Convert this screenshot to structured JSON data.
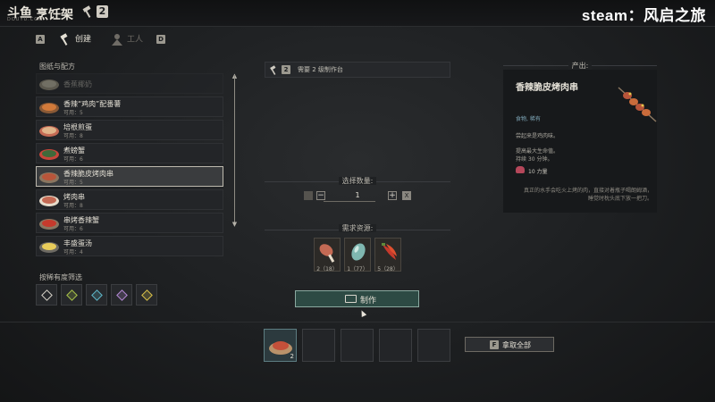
{
  "topbar": {
    "logo": "斗鱼",
    "logo_sub": "DOUYU.COM",
    "title": "烹饪架",
    "level_badge": "2",
    "watermark": "steam：风启之旅"
  },
  "tabs": {
    "prev_key": "A",
    "next_key": "D",
    "items": [
      {
        "label": "创建",
        "icon": "hammer-icon",
        "active": true
      },
      {
        "label": "工人",
        "icon": "worker-icon",
        "active": false
      }
    ]
  },
  "recipes": {
    "header": "图纸与配方",
    "items": [
      {
        "name": "香蕉椰奶",
        "sub": "",
        "faded": true,
        "selected": false,
        "icon": "coconut-milk-icon"
      },
      {
        "name": "香辣“鸡肉”配番薯",
        "sub": "可用：5",
        "faded": false,
        "selected": false,
        "icon": "chicken-plate-icon"
      },
      {
        "name": "培根煎蛋",
        "sub": "可用：8",
        "faded": false,
        "selected": false,
        "icon": "bacon-egg-icon"
      },
      {
        "name": "煮螃蟹",
        "sub": "可用：6",
        "faded": false,
        "selected": false,
        "icon": "crab-icon"
      },
      {
        "name": "香辣脆皮烤肉串",
        "sub": "可用：5",
        "faded": false,
        "selected": true,
        "icon": "skewer-icon"
      },
      {
        "name": "烤肉串",
        "sub": "可用：8",
        "faded": false,
        "selected": false,
        "icon": "meat-skewer-icon"
      },
      {
        "name": "串烤香辣蟹",
        "sub": "可用：6",
        "faded": false,
        "selected": false,
        "icon": "crab-skewer-icon"
      },
      {
        "name": "丰盛蛋汤",
        "sub": "可用：4",
        "faded": false,
        "selected": false,
        "icon": "egg-soup-icon"
      }
    ]
  },
  "filter": {
    "header": "按稀有度筛选",
    "gem_colors": [
      "#d8d4ca",
      "#a9c44a",
      "#5fb7c9",
      "#b58ad6",
      "#d9c24a"
    ]
  },
  "requirement": {
    "badge": "2",
    "text": "需要 2 级制作台"
  },
  "quantity": {
    "header": "选择数量:",
    "value": "1",
    "minus": "−",
    "plus": "+",
    "max_key": "X"
  },
  "resources": {
    "header": "需求资源:",
    "items": [
      {
        "icon": "raw-meat-icon",
        "count": "2（18）"
      },
      {
        "icon": "crystal-icon",
        "count": "1（77）"
      },
      {
        "icon": "chili-pepper-icon",
        "count": "5（28）"
      }
    ]
  },
  "craft": {
    "label": "制作"
  },
  "output": {
    "header": "产出:",
    "name": "香辣脆皮烤肉串",
    "tags": "食物, 稀有",
    "desc1": "尝起来是鸡肉味。",
    "desc2": "提高最大生命值。",
    "desc3": "持续 30 分钟。",
    "power": "10 力量",
    "quote_line1": "真正的水手会吃火上烤的肉，直接对着瓶子喝朗姆酒，",
    "quote_line2": "睡觉时枕头底下放一把刀。"
  },
  "queue": {
    "slots": [
      {
        "filled": true,
        "count": "2",
        "icon": "skewer-plate-icon"
      },
      {
        "filled": false,
        "count": ""
      },
      {
        "filled": false,
        "count": ""
      },
      {
        "filled": false,
        "count": ""
      },
      {
        "filled": false,
        "count": ""
      }
    ],
    "take_all_key": "F",
    "take_all_label": "拿取全部"
  }
}
